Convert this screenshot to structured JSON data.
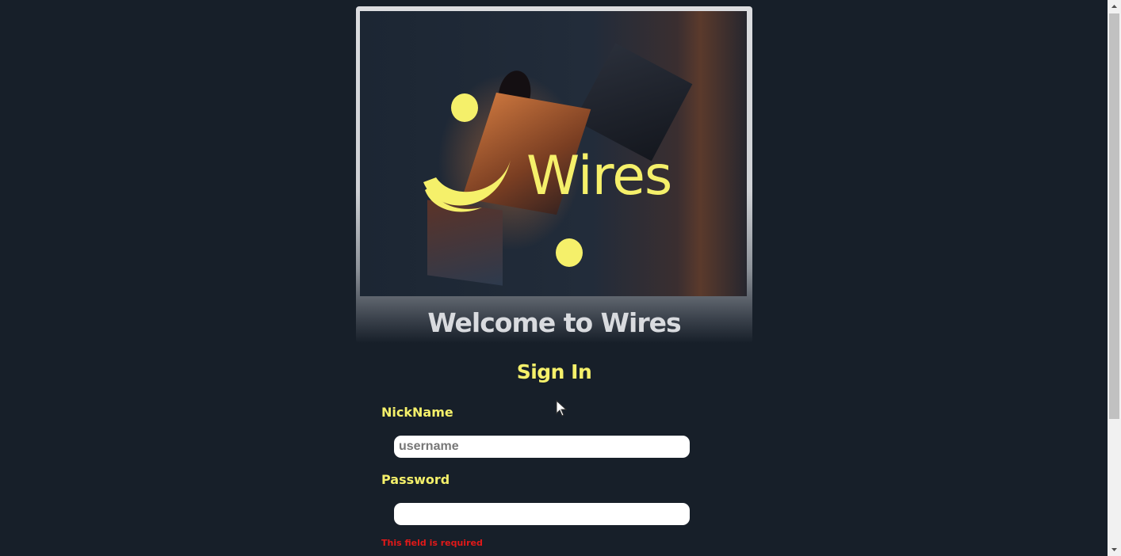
{
  "hero": {
    "logo_text": "Wires",
    "logo_color": "#f5f06a"
  },
  "welcome_title": "Welcome to Wires",
  "form": {
    "heading": "Sign In",
    "nickname_label": "NickName",
    "nickname_placeholder": "username",
    "nickname_value": "",
    "password_label": "Password",
    "password_value": "",
    "password_error": "This field is required"
  },
  "colors": {
    "background": "#171f29",
    "accent": "#f5f06a",
    "error": "#e11919"
  }
}
